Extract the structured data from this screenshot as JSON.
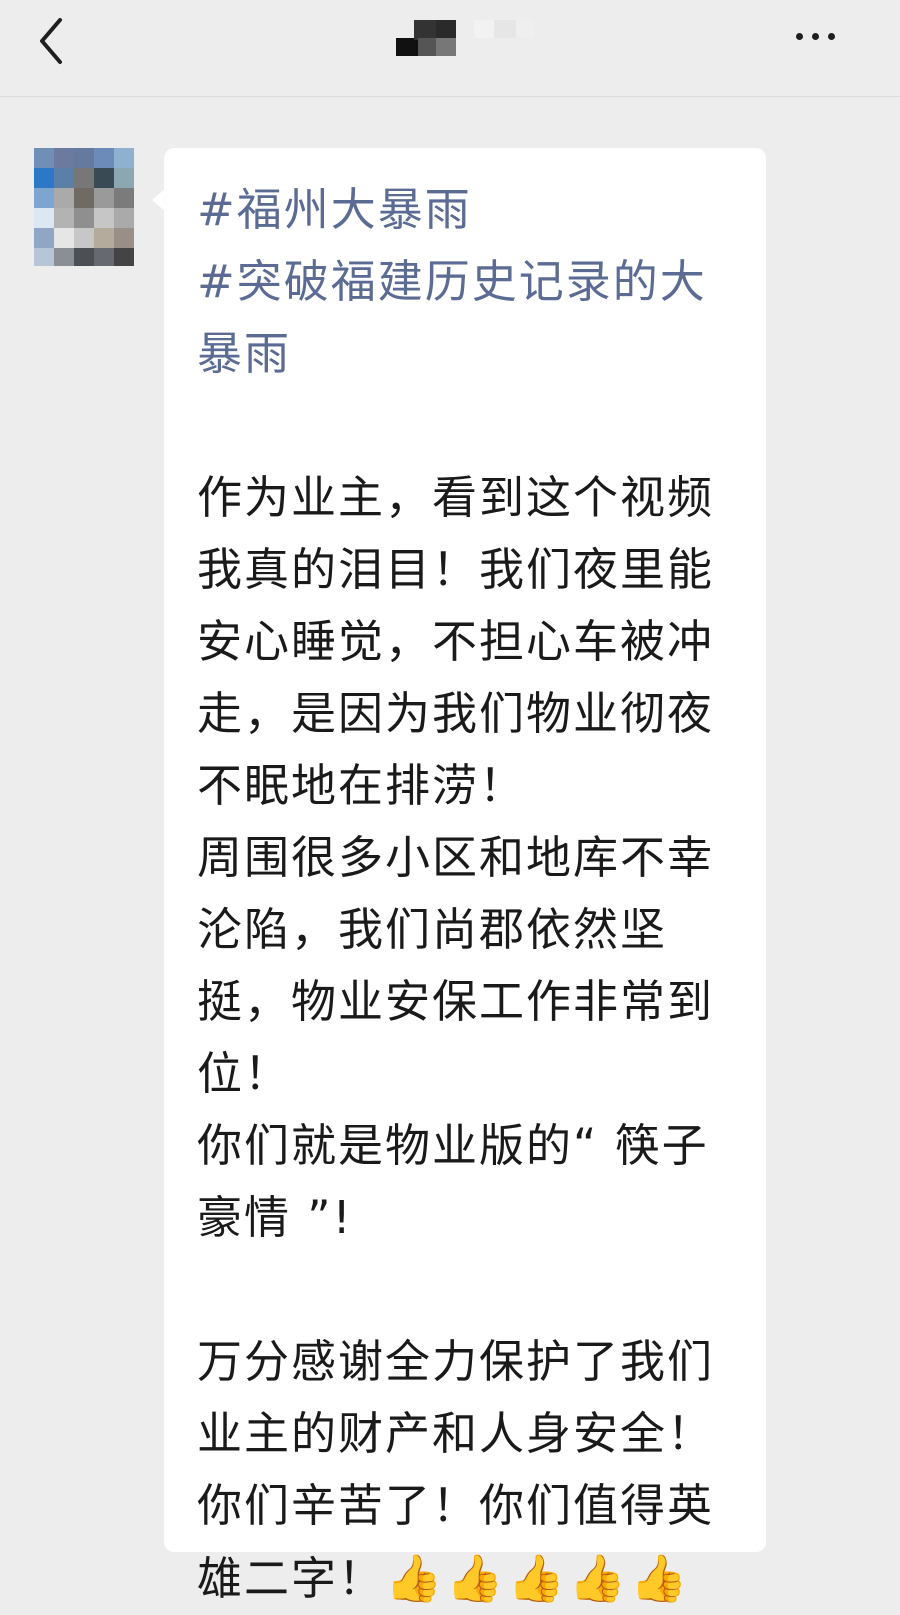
{
  "header": {
    "back_icon": "chevron-left-icon",
    "title_note": "",
    "more_icon": "more-horizontal-icon"
  },
  "avatar": {
    "icon": "user-avatar-icon"
  },
  "message": {
    "tags": [
      "#福州大暴雨",
      "#突破福建历史记录的大暴雨"
    ],
    "paragraph1": "作为业主，看到这个视频我真的泪目！我们夜里能安心睡觉，不担心车被冲走，是因为我们物业彻夜不眠地在排涝！\n周围很多小区和地库不幸沦陷，我们尚郡依然坚挺，物业安保工作非常到位！\n你们就是物业版的“ 筷子豪情 ”!",
    "paragraph2": "万分感谢全力保护了我们业主的财产和人身安全！\n你们辛苦了！你们值得英雄二字！",
    "emoji": "👍👍👍👍👍",
    "emoji_icon": "thumbs-up-icon"
  },
  "colors": {
    "background": "#ededed",
    "bubble": "#ffffff",
    "tag_text": "#5b6b93",
    "body_text": "#1a1a1a"
  }
}
